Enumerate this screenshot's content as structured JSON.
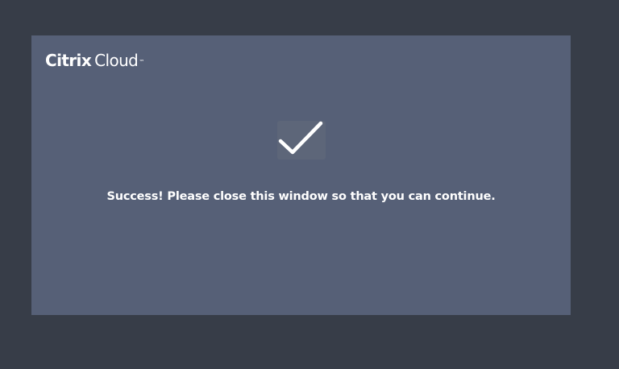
{
  "brand": {
    "name_part1": "Citrix",
    "name_part2": "Cloud",
    "trademark": "™"
  },
  "status": {
    "icon": "checkmark-icon",
    "message": "Success! Please close this window so that you can continue."
  },
  "colors": {
    "page_background": "#373d48",
    "dialog_background": "#566077",
    "text": "#ffffff"
  }
}
